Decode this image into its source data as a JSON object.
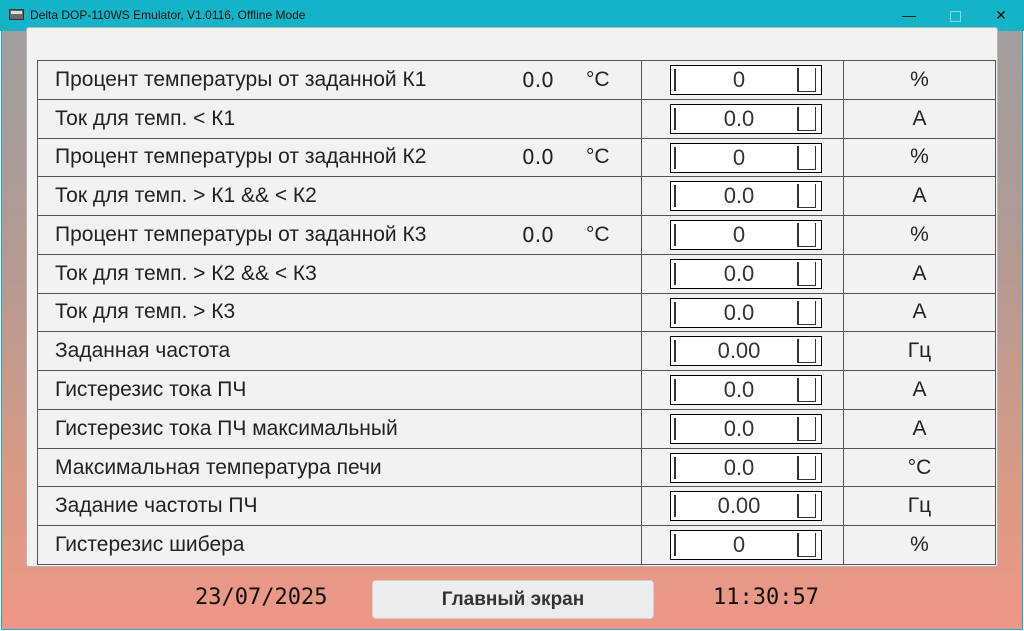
{
  "window": {
    "title": "Delta DOP-110WS Emulator, V1.0116, Offline Mode",
    "min_glyph": "—",
    "close_glyph": "✕"
  },
  "rows": [
    {
      "label": "Процент температуры от заданной К1",
      "temp_value": "0.0",
      "temp_unit": "°C",
      "value": "0",
      "unit": "%"
    },
    {
      "label": "Ток для темп. < К1",
      "value": "0.0",
      "unit": "A"
    },
    {
      "label": "Процент температуры от заданной К2",
      "temp_value": "0.0",
      "temp_unit": "°C",
      "value": "0",
      "unit": "%"
    },
    {
      "label": "Ток для темп. > К1 && < К2",
      "value": "0.0",
      "unit": "A"
    },
    {
      "label": "Процент температуры от заданной К3",
      "temp_value": "0.0",
      "temp_unit": "°C",
      "value": "0",
      "unit": "%"
    },
    {
      "label": "Ток для темп. > К2 && < К3",
      "value": "0.0",
      "unit": "A"
    },
    {
      "label": "Ток для темп. > К3",
      "value": "0.0",
      "unit": "A"
    },
    {
      "label": "Заданная частота",
      "value": "0.00",
      "unit": "Гц"
    },
    {
      "label": "Гистерезис тока ПЧ",
      "value": "0.0",
      "unit": "A"
    },
    {
      "label": "Гистерезис тока ПЧ максимальный",
      "value": "0.0",
      "unit": "A"
    },
    {
      "label": "Максимальная температура печи",
      "value": "0.0",
      "unit": "°C"
    },
    {
      "label": "Задание частоты ПЧ",
      "value": "0.00",
      "unit": "Гц"
    },
    {
      "label": "Гистерезис шибера",
      "value": "0",
      "unit": "%"
    }
  ],
  "footer": {
    "date": "23/07/2025",
    "main_button": "Главный экран",
    "time": "11:30:57"
  }
}
